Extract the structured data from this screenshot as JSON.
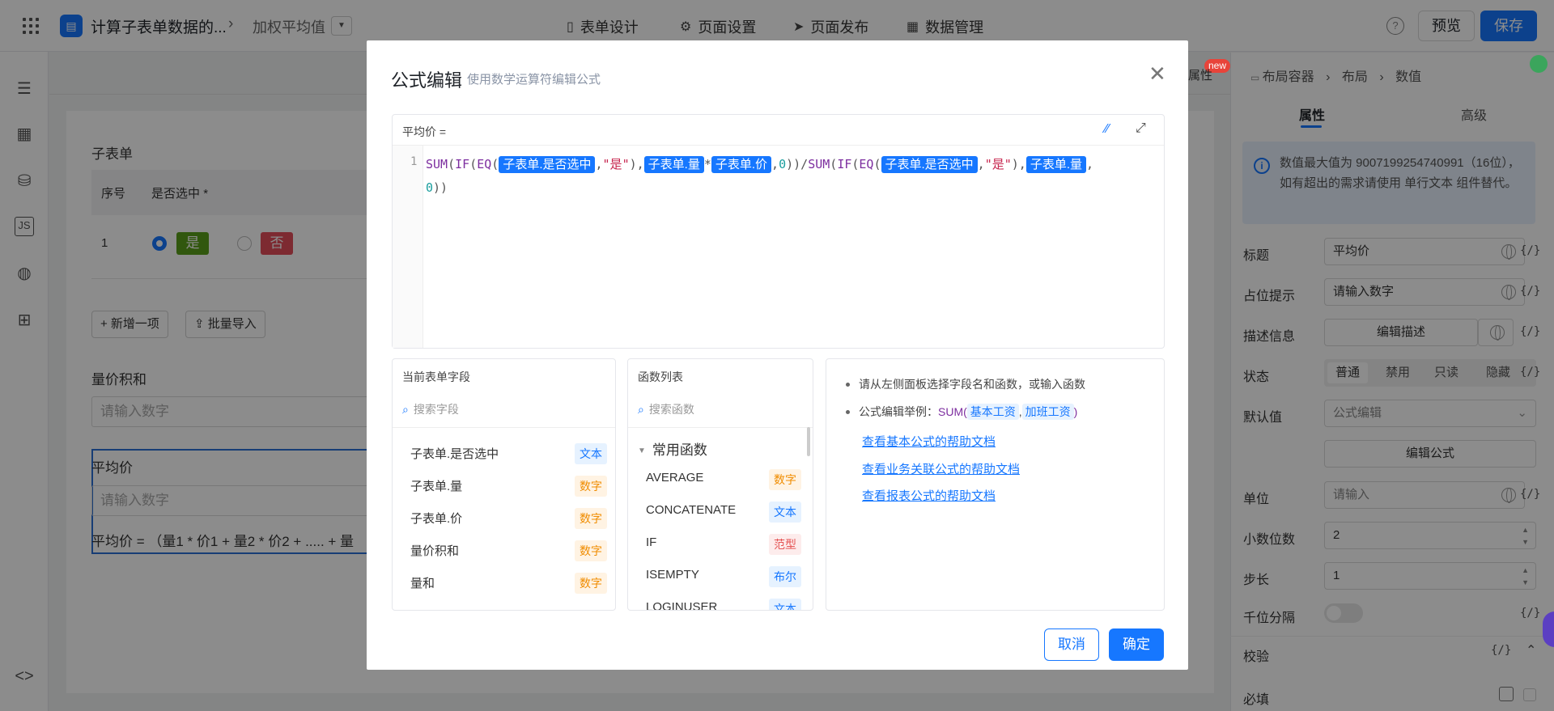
{
  "topbar": {
    "app_name": "计算子表单数据的...",
    "page_name": "加权平均值",
    "nav": [
      {
        "label": "表单设计",
        "icon": "form-icon"
      },
      {
        "label": "页面设置",
        "icon": "gear-icon"
      },
      {
        "label": "页面发布",
        "icon": "send-icon"
      },
      {
        "label": "数据管理",
        "icon": "table-icon"
      }
    ],
    "help": "?",
    "preview": "预览",
    "save": "保存"
  },
  "canvas": {
    "subform_title": "子表单",
    "col_index": "序号",
    "col_selected": "是否选中",
    "required_mark": "*",
    "row_index": "1",
    "opt_yes": "是",
    "opt_no": "否",
    "add_item": "+ 新增一项",
    "batch_import": "批量导入",
    "sum_label": "量价积和",
    "placeholder": "请输入数字",
    "avg_label": "平均价",
    "avg_desc": "平均价 = （量1 * 价1 + 量2 * 价2 + ..... + 量"
  },
  "right_panel": {
    "badge_new": "new",
    "attr_peek": "属性",
    "breadcrumb": [
      "布局容器",
      "布局",
      "数值"
    ],
    "tabs": [
      "属性",
      "高级"
    ],
    "info_text": "数值最大值为 9007199254740991（16位），如有超出的需求请使用 单行文本 组件替代。",
    "title_label": "标题",
    "title_value": "平均价",
    "placeholder_label": "占位提示",
    "placeholder_value": "请输入数字",
    "desc_label": "描述信息",
    "desc_btn": "编辑描述",
    "state_label": "状态",
    "state_options": [
      "普通",
      "禁用",
      "只读",
      "隐藏"
    ],
    "default_label": "默认值",
    "default_value": "公式编辑",
    "edit_formula": "编辑公式",
    "unit_label": "单位",
    "unit_placeholder": "请输入",
    "decimal_label": "小数位数",
    "decimal_value": "2",
    "step_label": "步长",
    "step_value": "1",
    "thousand_label": "千位分隔",
    "validate_label": "校验",
    "required_label": "必填",
    "fx": "{/}"
  },
  "modal": {
    "title": "公式编辑",
    "subtitle": "使用数学运算符编辑公式",
    "field_label": "平均价 =",
    "line_no": "1",
    "fields_title": "当前表单字段",
    "fields_search": "搜索字段",
    "fields": [
      {
        "name": "子表单.是否选中",
        "type": "文本",
        "kind": "text"
      },
      {
        "name": "子表单.量",
        "type": "数字",
        "kind": "num"
      },
      {
        "name": "子表单.价",
        "type": "数字",
        "kind": "num"
      },
      {
        "name": "量价积和",
        "type": "数字",
        "kind": "num"
      },
      {
        "name": "量和",
        "type": "数字",
        "kind": "num"
      }
    ],
    "funcs_title": "函数列表",
    "funcs_search": "搜索函数",
    "funcs_group": "常用函数",
    "funcs": [
      {
        "name": "AVERAGE",
        "type": "数字",
        "kind": "num"
      },
      {
        "name": "CONCATENATE",
        "type": "文本",
        "kind": "text"
      },
      {
        "name": "IF",
        "type": "范型",
        "kind": "gen"
      },
      {
        "name": "ISEMPTY",
        "type": "布尔",
        "kind": "bool"
      },
      {
        "name": "LOGINUSER",
        "type": "文本",
        "kind": "text"
      }
    ],
    "tip1": "请从左侧面板选择字段名和函数，或输入函数",
    "tip2_prefix": "公式编辑举例：",
    "tip2_fn": "SUM(",
    "tip2_a": "基本工资",
    "tip2_b": "加班工资",
    "tip2_end": ")",
    "links": [
      "查看基本公式的帮助文档",
      "查看业务关联公式的帮助文档",
      "查看报表公式的帮助文档"
    ],
    "cancel": "取消",
    "ok": "确定"
  }
}
